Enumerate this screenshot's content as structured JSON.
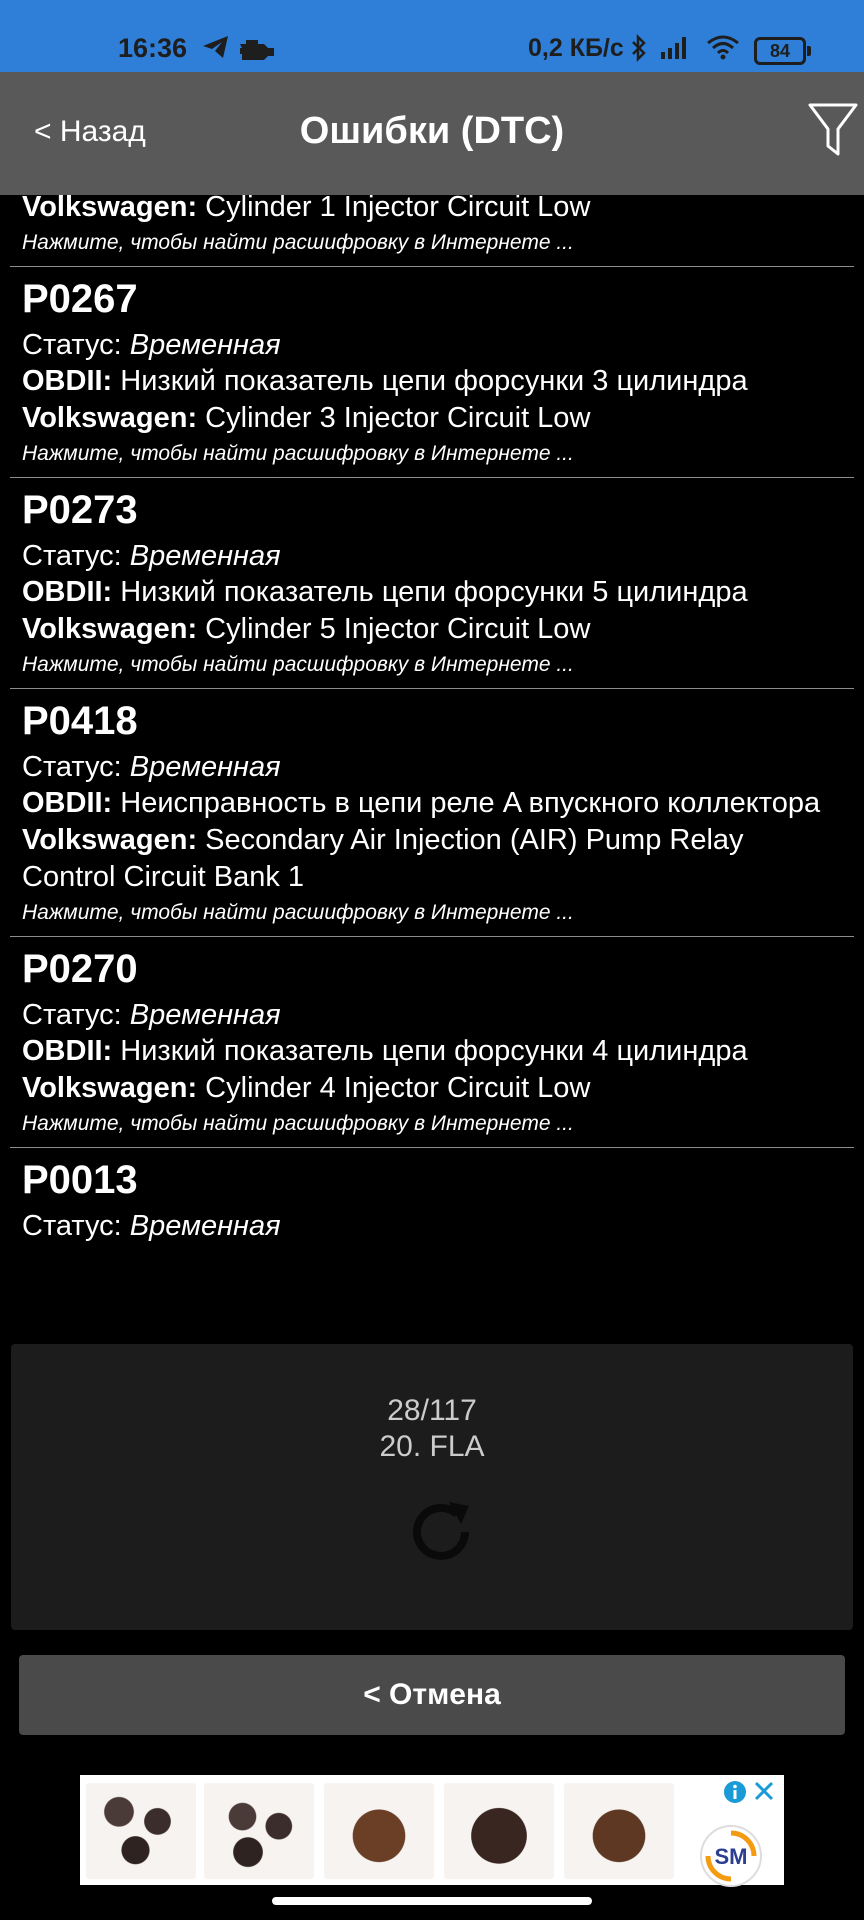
{
  "status_bar": {
    "time": "16:36",
    "speed": "0,2 КБ/с",
    "battery": "84",
    "icons": [
      "telegram-icon",
      "engine-icon",
      "bluetooth-icon",
      "signal-icon",
      "wifi-icon",
      "battery-icon"
    ]
  },
  "header": {
    "back_label": "< Назад",
    "title": "Ошибки (DTC)",
    "filter_icon": "filter-icon"
  },
  "partial_top": {
    "volks_label": "Volkswagen:",
    "volks_text": " Cylinder 1 Injector Circuit Low",
    "hint": "Нажмите, чтобы найти расшифровку в Интернете ..."
  },
  "entries": [
    {
      "code": "P0267",
      "status_label": "Статус:",
      "status": "Временная",
      "obd_label": "OBDII:",
      "obd_text": " Низкий показатель цепи форсунки 3 цилиндра",
      "volks_label": "Volkswagen:",
      "volks_text": " Cylinder 3 Injector Circuit Low",
      "hint": "Нажмите, чтобы найти расшифровку в Интернете ..."
    },
    {
      "code": "P0273",
      "status_label": "Статус:",
      "status": "Временная",
      "obd_label": "OBDII:",
      "obd_text": " Низкий показатель цепи форсунки 5 цилиндра",
      "volks_label": "Volkswagen:",
      "volks_text": " Cylinder 5 Injector Circuit Low",
      "hint": "Нажмите, чтобы найти расшифровку в Интернете ..."
    },
    {
      "code": "P0418",
      "status_label": "Статус:",
      "status": "Временная",
      "obd_label": "OBDII:",
      "obd_text": " Неисправность в цепи реле A впускного коллектора",
      "volks_label": "Volkswagen:",
      "volks_text": " Secondary Air Injection (AIR) Pump Relay Control Circuit Bank 1",
      "hint": "Нажмите, чтобы найти расшифровку в Интернете ..."
    },
    {
      "code": "P0270",
      "status_label": "Статус:",
      "status": "Временная",
      "obd_label": "OBDII:",
      "obd_text": " Низкий показатель цепи форсунки 4 цилиндра",
      "volks_label": "Volkswagen:",
      "volks_text": " Cylinder 4 Injector Circuit Low",
      "hint": "Нажмите, чтобы найти расшифровку в Интернете ..."
    },
    {
      "code": "P0013",
      "status_label": "Статус:",
      "status": "Временная"
    }
  ],
  "progress": {
    "count": "28/117",
    "step": "20. FLA",
    "icon": "refresh-icon"
  },
  "cancel_label": "< Отмена",
  "ad": {
    "images": [
      "pellets-image",
      "pellets-image",
      "ground-coffee-image",
      "ground-coffee-image",
      "ground-coffee-image"
    ],
    "logo_text": "SM",
    "colors": {
      "accent": "#1a9bd7",
      "logo_orange": "#f39c12",
      "logo_navy": "#2c3e8f"
    }
  }
}
